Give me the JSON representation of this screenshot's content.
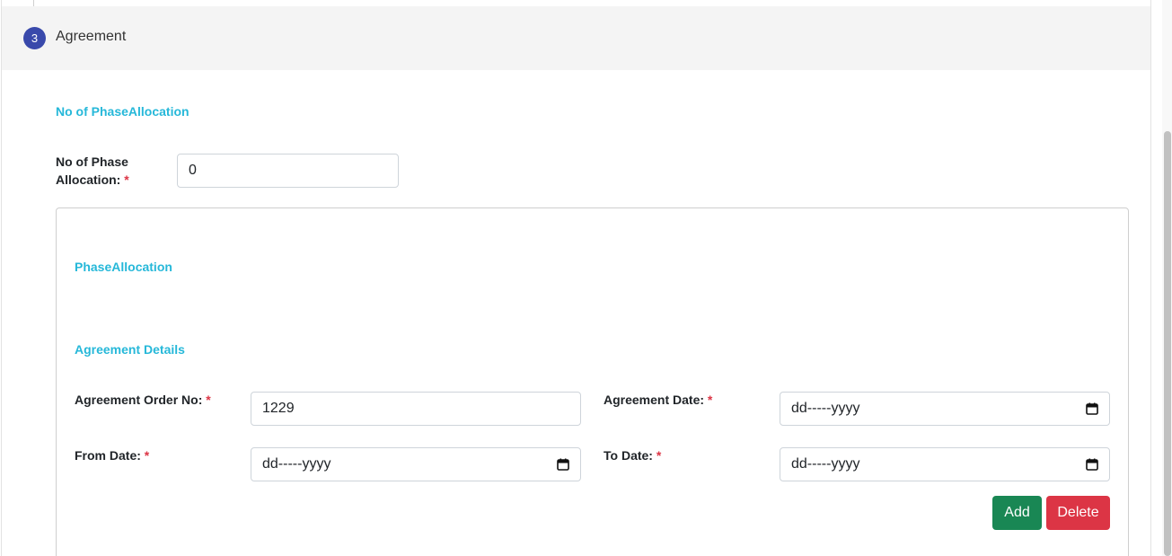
{
  "step": {
    "number": "3",
    "title": "Agreement"
  },
  "phase_count_section": {
    "title": "No of PhaseAllocation",
    "field_label_line1": "No of Phase",
    "field_label_line2": "Allocation:",
    "required_mark": "*",
    "value": "0"
  },
  "phase_allocation": {
    "title": "PhaseAllocation"
  },
  "agreement_details": {
    "title": "Agreement Details",
    "order_no_label": "Agreement Order No:",
    "order_no_value": "1229",
    "agreement_date_label": "Agreement Date:",
    "agreement_date_value": "dd-----yyyy",
    "from_date_label": "From Date:",
    "from_date_value": "dd-----yyyy",
    "to_date_label": "To Date:",
    "to_date_value": "dd-----yyyy",
    "required_mark": "*"
  },
  "actions": {
    "add_label": "Add",
    "delete_label": "Delete"
  },
  "colors": {
    "step_badge": "#3949ab",
    "section_title": "#26b8d9",
    "required": "#dc3545",
    "add_button": "#198754",
    "delete_button": "#dc3545"
  },
  "icons": {
    "calendar": "calendar-icon"
  }
}
